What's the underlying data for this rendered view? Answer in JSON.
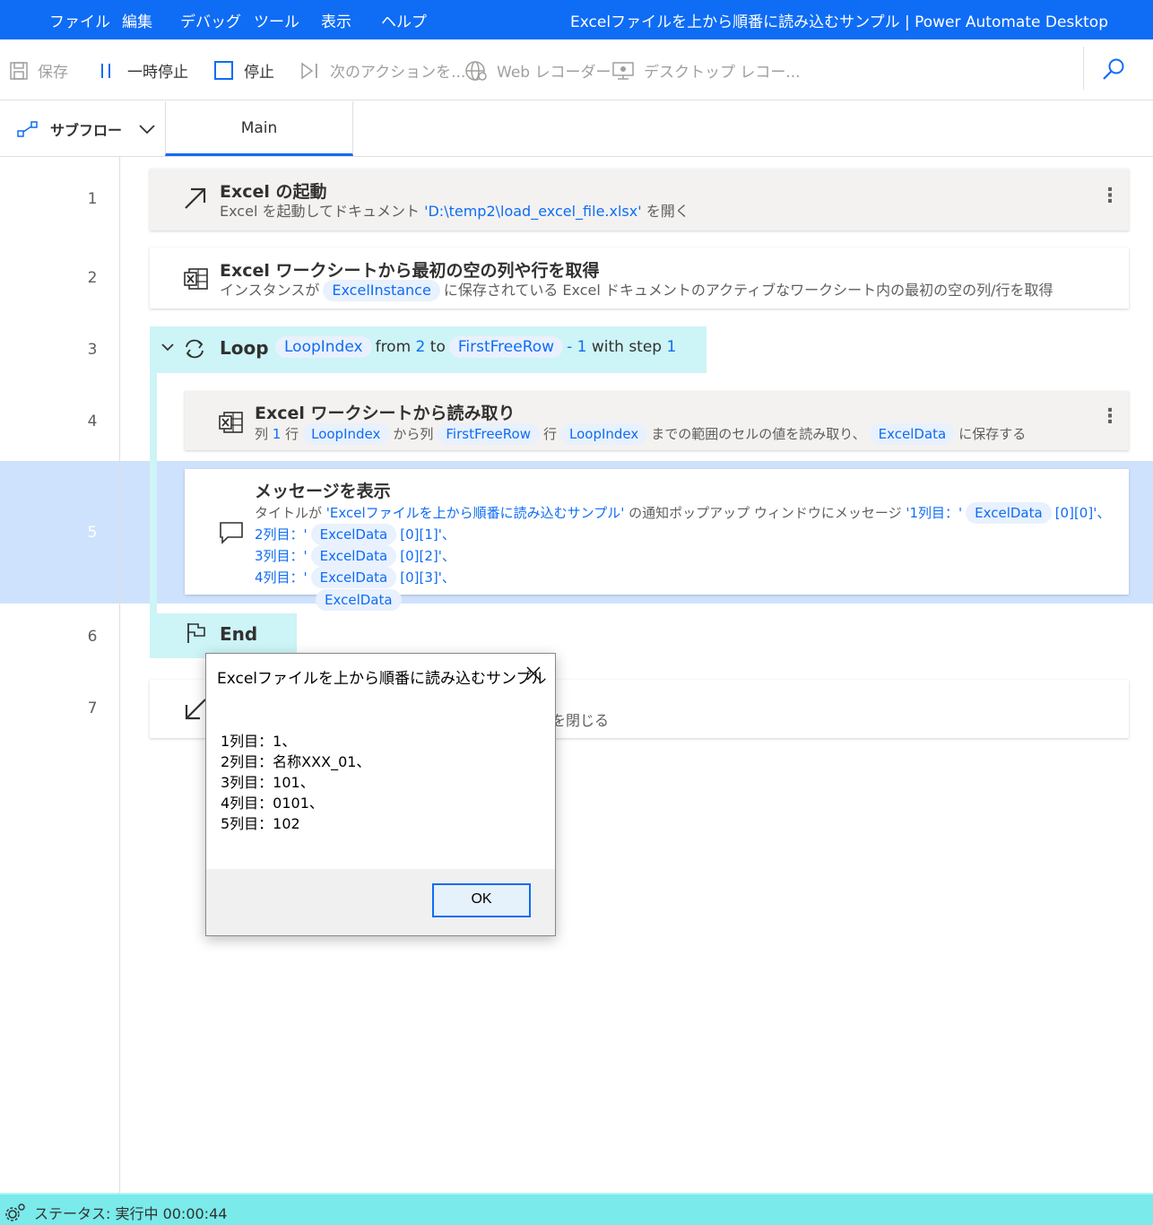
{
  "menubar": {
    "items": [
      "ファイル",
      "編集",
      "デバッグ",
      "ツール",
      "表示",
      "ヘルプ"
    ],
    "window_title": "Excelファイルを上から順番に読み込むサンプル | Power Automate Desktop"
  },
  "toolbar": {
    "save": "保存",
    "pause": "一時停止",
    "stop": "停止",
    "next_action": "次のアクションを...",
    "web_recorder": "Web レコーダー",
    "desktop_recorder": "デスクトップ レコー..."
  },
  "tabs": {
    "subflow": "サブフロー",
    "main": "Main"
  },
  "lines": [
    "1",
    "2",
    "3",
    "4",
    "5",
    "6",
    "7"
  ],
  "actions": {
    "a1": {
      "title": "Excel の起動",
      "d1": "Excel を起動してドキュメント ",
      "d2": "'D:\\temp2\\load_excel_file.xlsx'",
      "d3": " を開く"
    },
    "a2": {
      "title": "Excel ワークシートから最初の空の列や行を取得",
      "d1": "インスタンスが",
      "v1": "ExcelInstance",
      "d2": "に保存されている Excel ドキュメントのアクティブなワークシート内の最初の空の列/行を取得"
    },
    "loop": {
      "title": "Loop",
      "v1": "LoopIndex",
      "t1": "from ",
      "n1": "2",
      "t2": " to",
      "v2": "FirstFreeRow",
      "t3": "- ",
      "n2": "1",
      "t4": " with step ",
      "n3": "1"
    },
    "a4": {
      "title": "Excel ワークシートから読み取り",
      "t1": "列 ",
      "n1": "1",
      "t2": " 行",
      "v1": "LoopIndex",
      "t3": "から列",
      "v2": "FirstFreeRow",
      "t4": "行",
      "v3": "LoopIndex",
      "t5": "までの範囲のセルの値を読み取り、",
      "v4": "ExcelData",
      "t6": "に保存する"
    },
    "a5": {
      "title": "メッセージを表示",
      "l1a": "タイトルが ",
      "l1b": "'Excelファイルを上から順番に読み込むサンプル'",
      "l1c": " の通知ポップアップ ウィンドウにメッセージ ",
      "l1d": "'1列目：'",
      "l1v": "ExcelData",
      "l1e": "[0][0]'、",
      "l2a": "2列目：'",
      "l2v": "ExcelData",
      "l2e": "[0][1]'、",
      "l3a": "3列目：'",
      "l3v": "ExcelData",
      "l3e": "[0][2]'、",
      "l4a": "4列目：'",
      "l4v": "ExcelData",
      "l4e": "[0][3]'、",
      "l5v": "ExcelData"
    },
    "end": {
      "title": "End"
    },
    "a7": {
      "tail": "スを閉じる"
    }
  },
  "dialog": {
    "title": "Excelファイルを上から順番に読み込むサンプル",
    "lines": [
      "1列目：1、",
      "2列目：名称XXX_01、",
      "3列目：101、",
      "4列目：0101、",
      "5列目：102"
    ],
    "ok": "OK"
  },
  "status": {
    "text": "ステータス: 実行中  00:00:44"
  },
  "colors": {
    "accent": "#0f6cf5",
    "loop": "#cdf4f6",
    "selection": "#cfe2fd",
    "status": "#7aeaea"
  }
}
